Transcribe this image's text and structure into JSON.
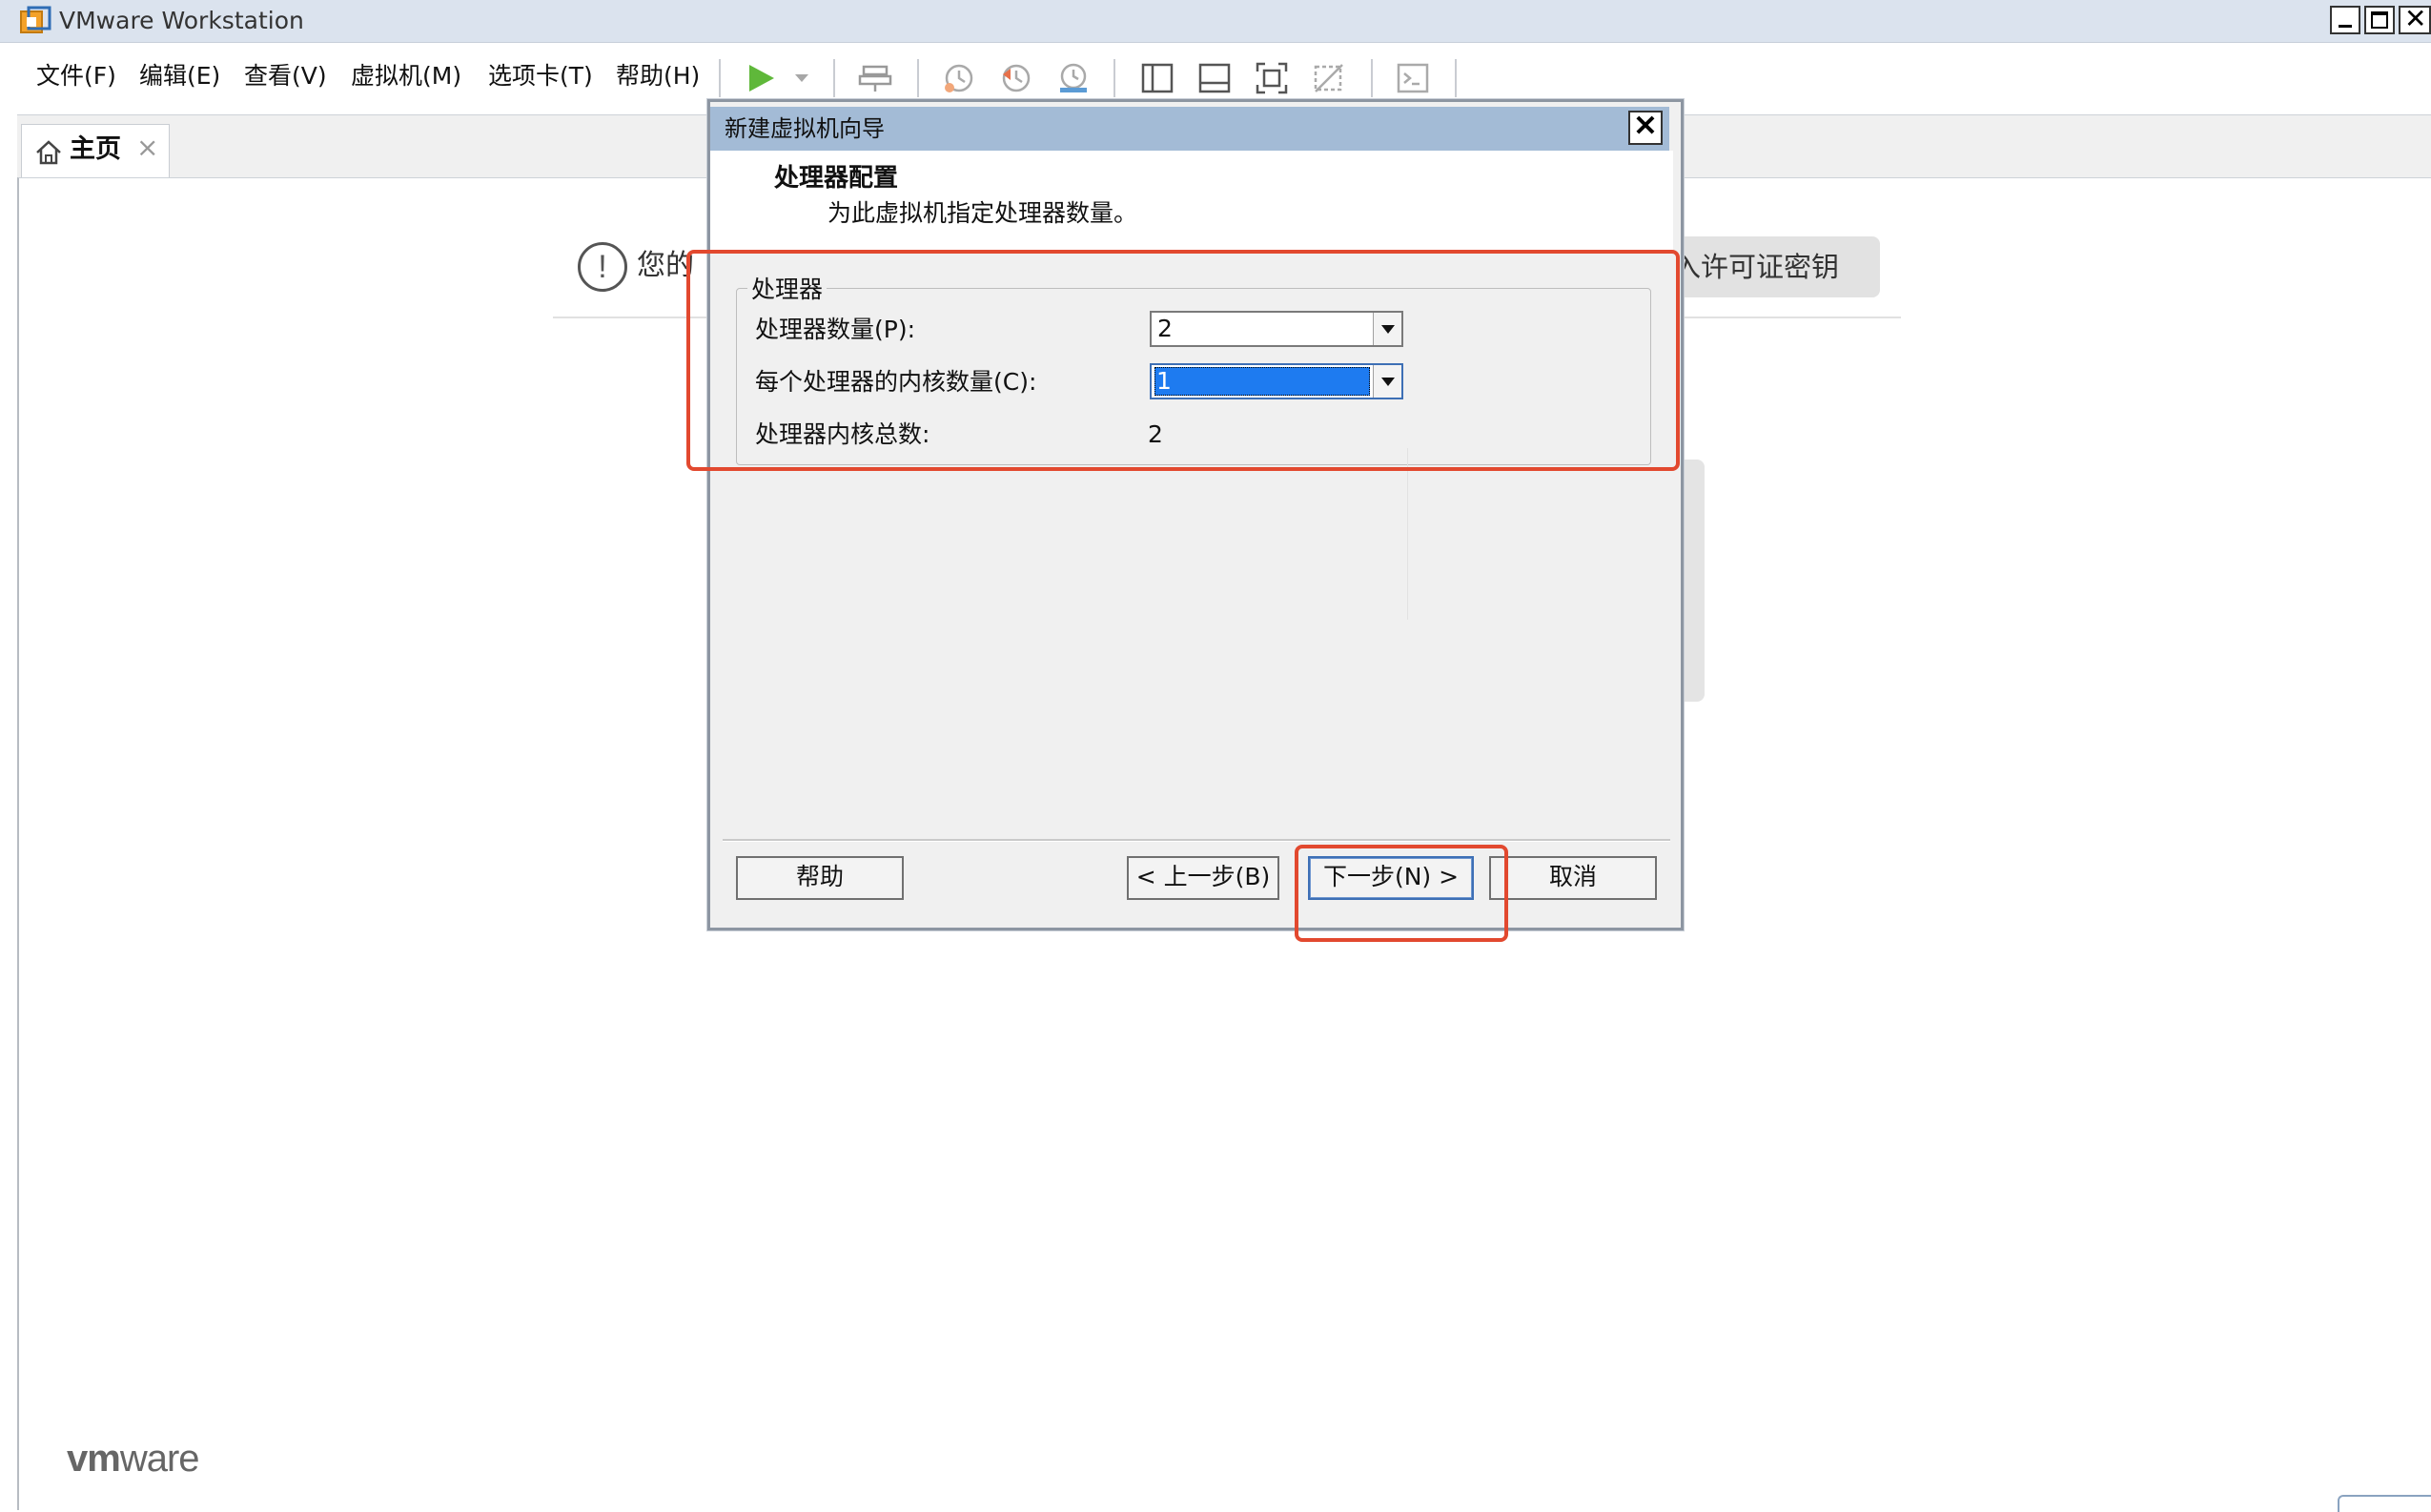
{
  "window": {
    "title": "VMware Workstation",
    "icon": "vmware-app-icon",
    "controls": [
      "minimize",
      "maximize",
      "close"
    ]
  },
  "menu": {
    "items": [
      "文件(F)",
      "编辑(E)",
      "查看(V)",
      "虚拟机(M)",
      "选项卡(T)",
      "帮助(H)"
    ]
  },
  "toolbar": {
    "icons": [
      "play-icon",
      "play-dropdown-icon",
      "send-keys-icon",
      "snapshot-icon",
      "revert-snapshot-icon",
      "snapshot-manager-icon",
      "library-view-icon",
      "thumbnail-bar-icon",
      "fullscreen-icon",
      "unity-icon",
      "console-icon"
    ],
    "play_color": "#5fb83a"
  },
  "tabs": [
    {
      "label": "主页",
      "icon": "home-icon",
      "close_glyph": "×"
    }
  ],
  "home": {
    "notice_text": "您的",
    "license_button": "入许可证密钥",
    "logo": {
      "prefix": "vm",
      "suffix": "ware"
    }
  },
  "dialog": {
    "title": "新建虚拟机向导",
    "close_glyph": "✕",
    "heading": "处理器配置",
    "subheading": "为此虚拟机指定处理器数量。",
    "group_label": "处理器",
    "processor_count": {
      "label": "处理器数量(P):",
      "value": "2"
    },
    "cores_per_processor": {
      "label": "每个处理器的内核数量(C):",
      "value": "1"
    },
    "total_cores": {
      "label": "处理器内核总数:",
      "value": "2"
    },
    "buttons": {
      "help": "帮助",
      "back": "< 上一步(B)",
      "next": "下一步(N) >",
      "cancel": "取消"
    }
  },
  "annotation_color": "#e2492f"
}
